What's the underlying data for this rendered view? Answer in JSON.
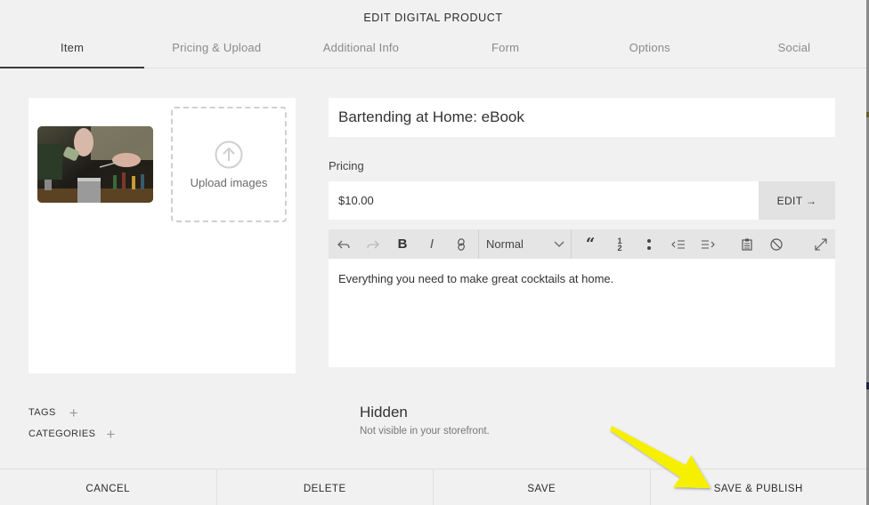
{
  "dialog": {
    "title": "EDIT DIGITAL PRODUCT",
    "tabs": [
      {
        "label": "Item",
        "active": true
      },
      {
        "label": "Pricing & Upload",
        "active": false
      },
      {
        "label": "Additional Info",
        "active": false
      },
      {
        "label": "Form",
        "active": false
      },
      {
        "label": "Options",
        "active": false
      },
      {
        "label": "Social",
        "active": false
      }
    ]
  },
  "images": {
    "thumbnail_alt": "Bartender pouring into a cocktail shaker",
    "upload_label": "Upload images",
    "upload_icon": "upload-arrow-circle-icon"
  },
  "product": {
    "title": "Bartending at Home: eBook",
    "pricing_label": "Pricing",
    "price": "$10.00",
    "edit_label": "EDIT →",
    "description": "Everything you need to make great cocktails at home."
  },
  "toolbar": {
    "format_value": "Normal",
    "icons": [
      "undo-icon",
      "redo-icon",
      "bold-icon",
      "italic-icon",
      "link-icon",
      "blockquote-icon",
      "numbered-list-icon",
      "bulleted-list-icon",
      "outdent-icon",
      "indent-icon",
      "paste-icon",
      "clear-format-icon",
      "expand-icon"
    ]
  },
  "meta": {
    "tags_label": "TAGS",
    "categories_label": "CATEGORIES",
    "add_glyph": "+"
  },
  "visibility": {
    "status": "Hidden",
    "description": "Not visible in your storefront."
  },
  "footer": {
    "cancel": "CANCEL",
    "delete": "DELETE",
    "save": "SAVE",
    "save_publish": "SAVE & PUBLISH"
  },
  "annotation": {
    "arrow_color": "#f6f000",
    "points_to": "SAVE & PUBLISH"
  }
}
